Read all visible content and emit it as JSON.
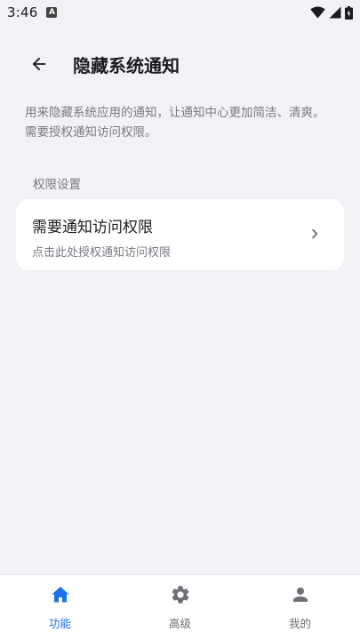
{
  "status_bar": {
    "time": "3:46",
    "notification_glyph": "A"
  },
  "app_bar": {
    "title": "隐藏系统通知",
    "back_icon": "arrow-left-icon"
  },
  "description": "用来隐藏系统应用的通知，让通知中心更加简洁、清爽。需要授权通知访问权限。",
  "section": {
    "label": "权限设置"
  },
  "permission_card": {
    "title": "需要通知访问权限",
    "subtitle": "点击此处授权通知访问权限",
    "icon": "chevron-right-icon"
  },
  "bottom_nav": {
    "items": [
      {
        "label": "功能",
        "icon": "home-icon",
        "active": true
      },
      {
        "label": "高级",
        "icon": "gear-icon",
        "active": false
      },
      {
        "label": "我的",
        "icon": "person-icon",
        "active": false
      }
    ]
  },
  "colors": {
    "accent": "#1a73e8",
    "background": "#f2f1f6",
    "card": "#ffffff",
    "secondary_text": "#7a7982"
  }
}
